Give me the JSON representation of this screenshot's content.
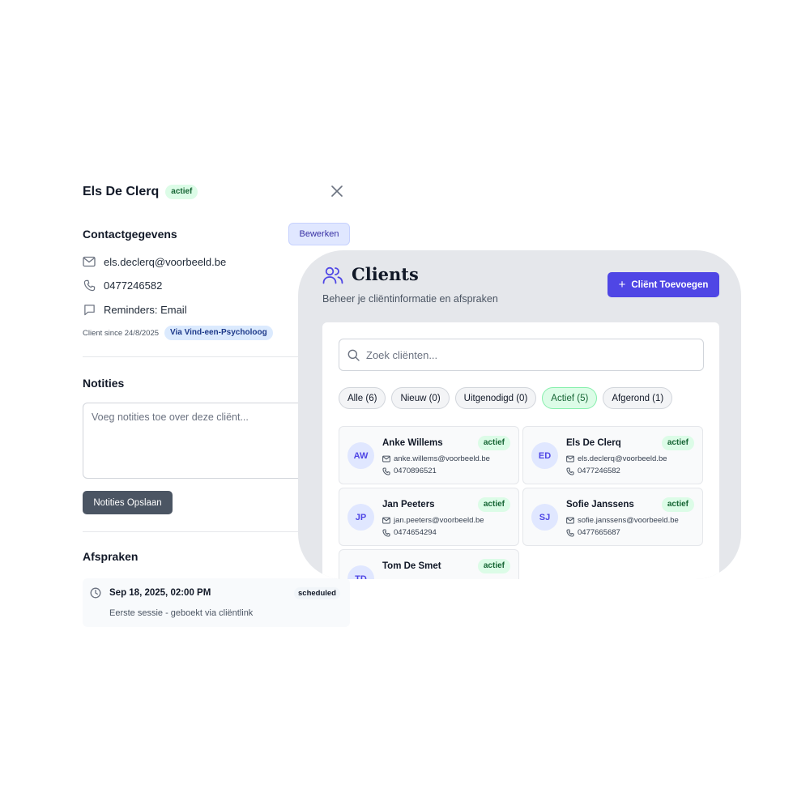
{
  "detail": {
    "name": "Els De Clerq",
    "status": "actief",
    "contact_title": "Contactgegevens",
    "edit_label": "Bewerken",
    "email": "els.declerq@voorbeeld.be",
    "phone": "0477246582",
    "reminders": "Reminders: Email",
    "since": "Client since 24/8/2025",
    "source": "Via Vind-een-Psycholoog",
    "notes_title": "Notities",
    "notes_placeholder": "Voeg notities toe over deze cliënt...",
    "save_notes_label": "Notities Opslaan",
    "appointments_title": "Afspraken",
    "appointments": [
      {
        "date": "Sep 18, 2025, 02:00 PM",
        "status": "scheduled",
        "description": "Eerste sessie - geboekt via cliëntlink"
      }
    ]
  },
  "clients": {
    "title": "Clients",
    "subtitle": "Beheer je cliëntinformatie en afspraken",
    "add_label": "Cliënt Toevoegen",
    "search_placeholder": "Zoek cliënten...",
    "filters": [
      {
        "label": "Alle (6)",
        "active": false
      },
      {
        "label": "Nieuw (0)",
        "active": false
      },
      {
        "label": "Uitgenodigd (0)",
        "active": false
      },
      {
        "label": "Actief (5)",
        "active": true
      },
      {
        "label": "Afgerond (1)",
        "active": false
      }
    ],
    "list": [
      {
        "initials": "AW",
        "name": "Anke Willems",
        "status": "actief",
        "email": "anke.willems@voorbeeld.be",
        "phone": "0470896521"
      },
      {
        "initials": "ED",
        "name": "Els De Clerq",
        "status": "actief",
        "email": "els.declerq@voorbeeld.be",
        "phone": "0477246582"
      },
      {
        "initials": "JP",
        "name": "Jan Peeters",
        "status": "actief",
        "email": "jan.peeters@voorbeeld.be",
        "phone": "0474654294"
      },
      {
        "initials": "SJ",
        "name": "Sofie Janssens",
        "status": "actief",
        "email": "sofie.janssens@voorbeeld.be",
        "phone": "0477665687"
      },
      {
        "initials": "TD",
        "name": "Tom De Smet",
        "status": "actief",
        "email": "",
        "phone": ""
      }
    ]
  },
  "colors": {
    "accent": "#4f46e5",
    "status_active_bg": "#dcfce7",
    "status_active_text": "#166534",
    "source_badge_bg": "#dbeafe"
  }
}
